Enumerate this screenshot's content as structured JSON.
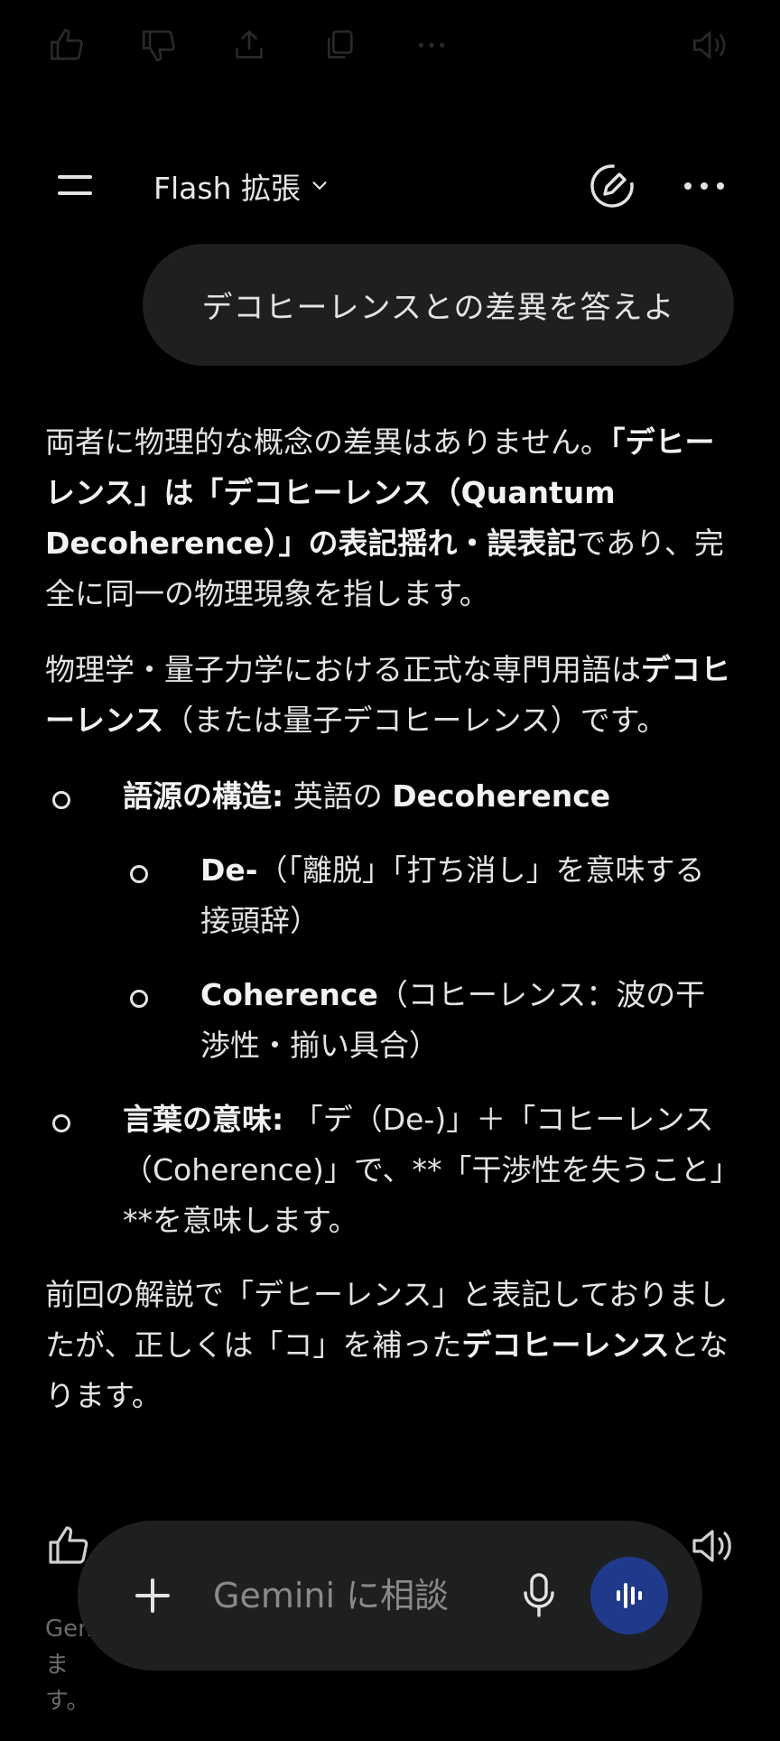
{
  "header": {
    "model_label": "Flash 拡張"
  },
  "user_message": "デコヒーレンスとの差異を答えよ",
  "response": {
    "p1_a": "両者に物理的な概念の差異はありません。",
    "p1_b": "「デヒーレンス」は「デコヒーレンス（Quantum Decoherence）」の表記揺れ・誤表記",
    "p1_c": "であり、完全に同一の物理現象を指します。",
    "p2_a": "物理学・量子力学における正式な専門用語は",
    "p2_b": "デコヒーレンス",
    "p2_c": "（または量子デコヒーレンス）です。",
    "bullets": [
      {
        "label": "語源の構造:",
        "text": " 英語の ",
        "term": "Decoherence",
        "sub": [
          {
            "term": "De-",
            "text": "（「離脱」「打ち消し」を意味する接頭辞）"
          },
          {
            "term": "Coherence",
            "text": "（コヒーレンス：波の干渉性・揃い具合）"
          }
        ]
      },
      {
        "label": "言葉の意味:",
        "text": " 「デ（De-)」＋「コヒーレンス（Coherence)」で、**「干渉性を失うこと」**を意味します。"
      }
    ],
    "p3_a": "前回の解説で「デヒーレンス」と表記しておりましたが、正しくは「コ」を補った",
    "p3_b": "デコヒーレンス",
    "p3_c": "となります。"
  },
  "footer": {
    "disclaimer_start": "Gem",
    "disclaimer_end": "す。",
    "disclaimer_tail": "ま"
  },
  "input": {
    "placeholder": "Gemini に相談"
  },
  "icons": {
    "menu": "menu-icon",
    "chevron": "chevron-down-icon",
    "new_chat": "edit-pencil-icon",
    "more": "more-horizontal-icon",
    "add": "plus-icon",
    "mic": "microphone-icon",
    "live": "live-waveform-icon",
    "thumb_up": "thumb-up-icon",
    "speaker": "speaker-icon"
  },
  "colors": {
    "background": "#000000",
    "bubble": "#1e1f20",
    "live_button": "#1f3a8a",
    "text": "#e3e3e3"
  }
}
